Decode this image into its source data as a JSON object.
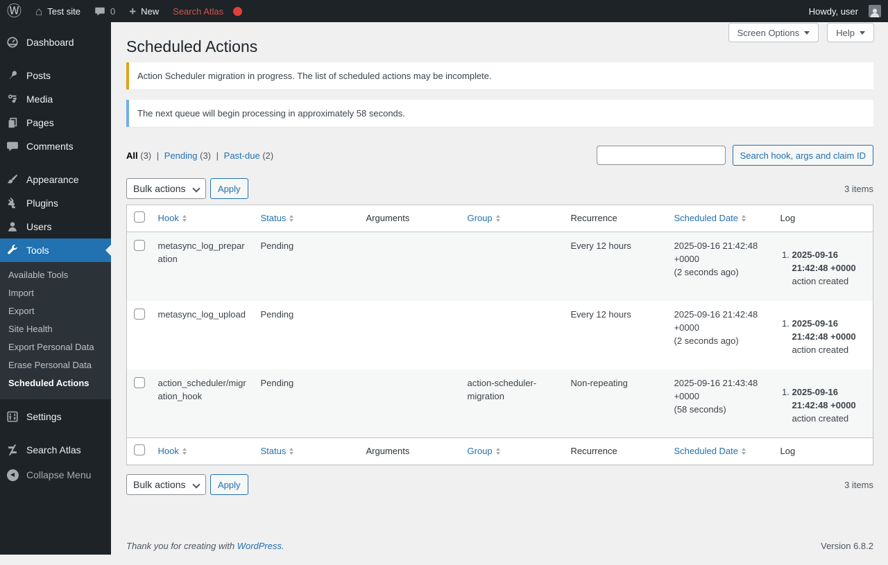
{
  "colors": {
    "accent_blue": "#2271b1",
    "notice_warning_border": "#dba617",
    "notice_info_border": "#72aee6",
    "alert_red_dot": "#e0403a",
    "menu_bg": "#1d2327",
    "submenu_bg": "#2c3338",
    "row_stripe": "#f6f7f7"
  },
  "icons": {
    "wordpress_logo_glyph": "Ⓦ",
    "home_glyph": "⌂",
    "new_plus_glyph": "+",
    "collapse_arrow_glyph": "◀"
  },
  "admin_bar": {
    "site_name": "Test site",
    "comments_count": "0",
    "new_label": "New",
    "search_atlas_label": "Search Atlas",
    "howdy": "Howdy, user"
  },
  "sidebar": {
    "items": [
      {
        "label": "Dashboard"
      },
      {
        "label": "Posts"
      },
      {
        "label": "Media"
      },
      {
        "label": "Pages"
      },
      {
        "label": "Comments"
      },
      {
        "label": "Appearance"
      },
      {
        "label": "Plugins"
      },
      {
        "label": "Users"
      },
      {
        "label": "Tools",
        "active": true
      },
      {
        "label": "Settings"
      },
      {
        "label": "Search Atlas"
      }
    ],
    "tools_submenu": [
      {
        "label": "Available Tools"
      },
      {
        "label": "Import"
      },
      {
        "label": "Export"
      },
      {
        "label": "Site Health"
      },
      {
        "label": "Export Personal Data"
      },
      {
        "label": "Erase Personal Data"
      },
      {
        "label": "Scheduled Actions",
        "current": true
      }
    ],
    "collapse_label": "Collapse Menu"
  },
  "header": {
    "title": "Scheduled Actions",
    "screen_options_label": "Screen Options",
    "help_label": "Help"
  },
  "notices": [
    {
      "text": "Action Scheduler migration in progress. The list of scheduled actions may be incomplete."
    },
    {
      "text": "The next queue will begin processing in approximately 58 seconds."
    }
  ],
  "filters": {
    "separator": "|",
    "items": [
      {
        "label": "All",
        "count": "(3)",
        "current": true
      },
      {
        "label": "Pending",
        "count": "(3)"
      },
      {
        "label": "Past-due",
        "count": "(2)"
      }
    ]
  },
  "search": {
    "value": "",
    "button_label": "Search hook, args and claim ID"
  },
  "bulk": {
    "select_label": "Bulk actions",
    "apply_label": "Apply",
    "items_count": "3 items"
  },
  "table": {
    "columns": [
      {
        "label": "Hook",
        "sortable": true
      },
      {
        "label": "Status",
        "sortable": true
      },
      {
        "label": "Arguments",
        "sortable": false
      },
      {
        "label": "Group",
        "sortable": true
      },
      {
        "label": "Recurrence",
        "sortable": false
      },
      {
        "label": "Scheduled Date",
        "sortable": true
      },
      {
        "label": "Log",
        "sortable": false
      }
    ],
    "rows": [
      {
        "hook": "metasync_log_preparation",
        "status": "Pending",
        "arguments": "",
        "group": "",
        "recurrence": "Every 12 hours",
        "scheduled": "2025-09-16 21:42:48 +0000",
        "scheduled_ago": "(2 seconds ago)",
        "log_date": "2025-09-16 21:42:48 +0000",
        "log_text": "action created"
      },
      {
        "hook": "metasync_log_upload",
        "status": "Pending",
        "arguments": "",
        "group": "",
        "recurrence": "Every 12 hours",
        "scheduled": "2025-09-16 21:42:48 +0000",
        "scheduled_ago": "(2 seconds ago)",
        "log_date": "2025-09-16 21:42:48 +0000",
        "log_text": "action created"
      },
      {
        "hook": "action_scheduler/migration_hook",
        "status": "Pending",
        "arguments": "",
        "group": "action-scheduler-migration",
        "recurrence": "Non-repeating",
        "scheduled": "2025-09-16 21:43:48 +0000",
        "scheduled_ago": "(58 seconds)",
        "log_date": "2025-09-16 21:42:48 +0000",
        "log_text": "action created"
      }
    ]
  },
  "footer": {
    "thanks_prefix": "Thank you for creating with",
    "wordpress_link": "WordPress",
    "period": ".",
    "version": "Version 6.8.2"
  }
}
